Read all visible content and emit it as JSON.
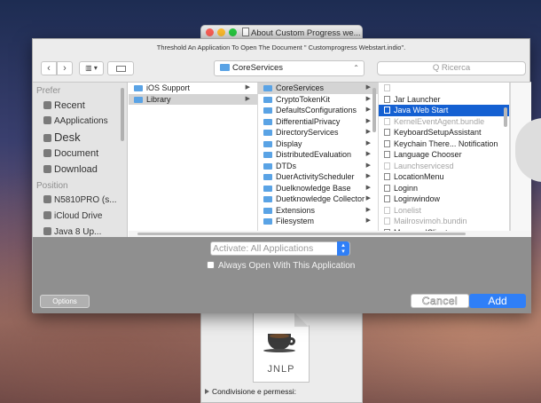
{
  "info_window": {
    "title": "About Custom Progress we...",
    "file_type_label": "JNLP",
    "section_label": "Condivisione e permessi:"
  },
  "dialog": {
    "message": "Threshold An Application To Open The Document \" Customprogress Webstart.indio\".",
    "toolbar": {
      "back_label": "‹",
      "forward_label": "›",
      "view_label": "▥ ▾",
      "location": "CoreServices",
      "search_placeholder": "Q Ricerca"
    },
    "sidebar": {
      "favorites_heading": "Prefer",
      "favorites": [
        {
          "label": "Recent",
          "icon": "clock-icon"
        },
        {
          "label": "AApplications",
          "icon": "applications-icon"
        },
        {
          "label": "Desk",
          "icon": "desktop-icon"
        },
        {
          "label": "Document",
          "icon": "document-icon"
        },
        {
          "label": "Download",
          "icon": "download-icon"
        }
      ],
      "locations_heading": "Position",
      "locations": [
        {
          "label": "N5810PRO (s...",
          "icon": "computer-icon"
        },
        {
          "label": "iCloud Drive",
          "icon": "cloud-icon"
        },
        {
          "label": "Java 8 Up...",
          "icon": "disk-icon"
        }
      ]
    },
    "columns": {
      "col1": [
        {
          "label": "iOS Support",
          "type": "folder",
          "arrow": true,
          "state": ""
        },
        {
          "label": "Library",
          "type": "folder",
          "arrow": true,
          "state": "selected-gray"
        }
      ],
      "col2": [
        {
          "label": "CoreServices",
          "type": "folder",
          "arrow": true,
          "state": "selected-gray"
        },
        {
          "label": "CryptoTokenKit",
          "type": "folder",
          "arrow": true,
          "state": ""
        },
        {
          "label": "DefaultsConfigurations",
          "type": "folder",
          "arrow": true,
          "state": ""
        },
        {
          "label": "DifferentialPrivacy",
          "type": "folder",
          "arrow": true,
          "state": ""
        },
        {
          "label": "DirectoryServices",
          "type": "folder",
          "arrow": true,
          "state": ""
        },
        {
          "label": "Display",
          "type": "folder",
          "arrow": true,
          "state": ""
        },
        {
          "label": "DistributedEvaluation",
          "type": "folder",
          "arrow": true,
          "state": ""
        },
        {
          "label": "DTDs",
          "type": "folder",
          "arrow": true,
          "state": ""
        },
        {
          "label": "DuerActivityScheduler",
          "type": "folder",
          "arrow": true,
          "state": ""
        },
        {
          "label": "Duelknowledge Base",
          "type": "folder",
          "arrow": true,
          "state": ""
        },
        {
          "label": "Duetknowledge Collector",
          "type": "folder",
          "arrow": true,
          "state": ""
        },
        {
          "label": "Extensions",
          "type": "folder",
          "arrow": true,
          "state": ""
        },
        {
          "label": "Filesystem",
          "type": "folder",
          "arrow": true,
          "state": ""
        }
      ],
      "col3": [
        {
          "label": "",
          "type": "doc",
          "state": "dim"
        },
        {
          "label": "Jar Launcher",
          "type": "doc",
          "state": ""
        },
        {
          "label": "Java Web Start",
          "type": "doc",
          "state": "selected-blue"
        },
        {
          "label": "KernelEventAgent.bundle",
          "type": "doc",
          "state": "dim"
        },
        {
          "label": "KeyboardSetupAssistant",
          "type": "doc",
          "state": ""
        },
        {
          "label": "Keychain There... Notification",
          "type": "doc",
          "state": ""
        },
        {
          "label": "Language Chooser",
          "type": "doc",
          "state": ""
        },
        {
          "label": "Launchservicesd",
          "type": "doc",
          "state": "dim"
        },
        {
          "label": "LocationMenu",
          "type": "doc",
          "state": ""
        },
        {
          "label": "Loginn",
          "type": "doc",
          "state": ""
        },
        {
          "label": "Loginwindow",
          "type": "doc",
          "state": ""
        },
        {
          "label": "Lonelist",
          "type": "doc",
          "state": "dim"
        },
        {
          "label": "Mailrosvimoh.bundin",
          "type": "doc",
          "state": "dim"
        },
        {
          "label": "ManagedClient",
          "type": "doc",
          "state": ""
        }
      ]
    },
    "enable_value": "Activate: All Applications",
    "always_open_label": "Always Open With This Application",
    "options_label": "Options",
    "cancel_label": "Cancel",
    "add_label": "Add"
  }
}
